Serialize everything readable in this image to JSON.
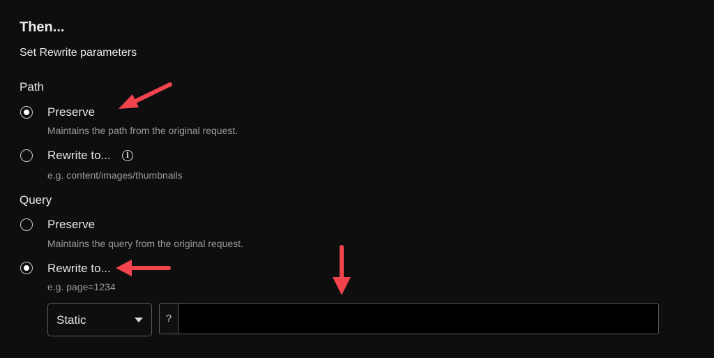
{
  "header": {
    "title": "Then...",
    "subtitle": "Set Rewrite parameters"
  },
  "path": {
    "label": "Path",
    "options": [
      {
        "label": "Preserve",
        "help": "Maintains the path from the original request.",
        "selected": true
      },
      {
        "label": "Rewrite to...",
        "help": "e.g. content/images/thumbnails",
        "selected": false,
        "info_icon": "info-icon"
      }
    ]
  },
  "query": {
    "label": "Query",
    "options": [
      {
        "label": "Preserve",
        "help": "Maintains the query from the original request.",
        "selected": false
      },
      {
        "label": "Rewrite to...",
        "help": "e.g. page=1234",
        "selected": true
      }
    ],
    "type_select": {
      "value": "Static"
    },
    "value_input": {
      "prefix": "?",
      "value": "",
      "placeholder": ""
    }
  },
  "annotations": {
    "arrow_color": "#f2444c"
  },
  "colors": {
    "background": "#0e0e0e",
    "text": "#e6e6e6",
    "muted": "#9a9a9a",
    "border": "#5b5b5b"
  }
}
